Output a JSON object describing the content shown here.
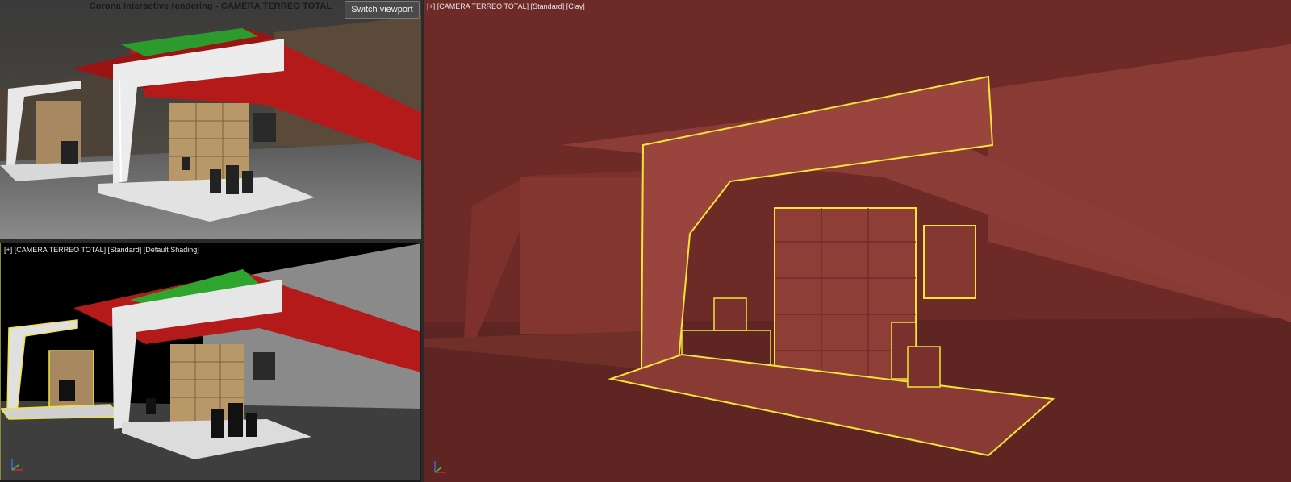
{
  "render_window": {
    "title": "Corona Interactive rendering - CAMERA TERREO TOTAL",
    "switch_button": "Switch viewport"
  },
  "viewport_shaded": {
    "plus": "[+]",
    "camera": "[CAMERA TERREO TOTAL]",
    "mode": "[Standard]",
    "shading": "[Default Shading]"
  },
  "viewport_clay": {
    "plus": "[+]",
    "camera": "[CAMERA TERREO TOTAL]",
    "mode": "[Standard]",
    "shading": "[Clay]"
  },
  "colors": {
    "clay": "#7a2f2b",
    "selection": "#f2e33a",
    "canopy_red": "#b81818",
    "canopy_green": "#2ea52e",
    "wood": "#b89868"
  },
  "icons": {
    "axis_gizmo": "xyz-axis-icon"
  }
}
